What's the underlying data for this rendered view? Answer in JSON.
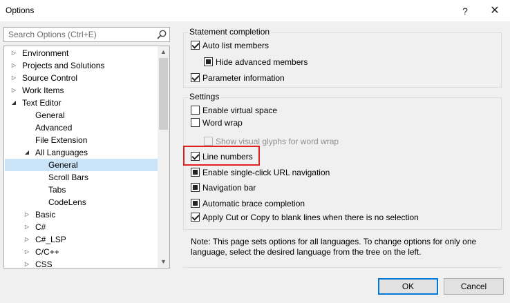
{
  "window": {
    "title": "Options",
    "help_glyph": "?",
    "close_glyph": "✕"
  },
  "search": {
    "placeholder": "Search Options (Ctrl+E)",
    "value": ""
  },
  "tree": {
    "items": [
      {
        "label": "Environment",
        "arrow": "closed"
      },
      {
        "label": "Projects and Solutions",
        "arrow": "closed"
      },
      {
        "label": "Source Control",
        "arrow": "closed"
      },
      {
        "label": "Work Items",
        "arrow": "closed"
      },
      {
        "label": "Text Editor",
        "arrow": "open"
      },
      {
        "label": "General",
        "arrow": "none"
      },
      {
        "label": "Advanced",
        "arrow": "none"
      },
      {
        "label": "File Extension",
        "arrow": "none"
      },
      {
        "label": "All Languages",
        "arrow": "open"
      },
      {
        "label": "General",
        "arrow": "none",
        "selected": true
      },
      {
        "label": "Scroll Bars",
        "arrow": "none"
      },
      {
        "label": "Tabs",
        "arrow": "none"
      },
      {
        "label": "CodeLens",
        "arrow": "none"
      },
      {
        "label": "Basic",
        "arrow": "closed"
      },
      {
        "label": "C#",
        "arrow": "closed"
      },
      {
        "label": "C#_LSP",
        "arrow": "closed"
      },
      {
        "label": "C/C++",
        "arrow": "closed"
      },
      {
        "label": "CSS",
        "arrow": "closed"
      }
    ]
  },
  "statement_completion": {
    "header": "Statement completion",
    "options": [
      {
        "label": "Auto list members",
        "state": "checked"
      },
      {
        "label": "Hide advanced members",
        "state": "indeterminate"
      },
      {
        "label": "Parameter information",
        "state": "checked"
      }
    ]
  },
  "settings": {
    "header": "Settings",
    "options": [
      {
        "label": "Enable virtual space",
        "state": "unchecked"
      },
      {
        "label": "Word wrap",
        "state": "unchecked"
      },
      {
        "label": "Show visual glyphs for word wrap",
        "state": "disabled"
      },
      {
        "label": "Line numbers",
        "state": "checked"
      },
      {
        "label": "Enable single-click URL navigation",
        "state": "indeterminate"
      },
      {
        "label": "Navigation bar",
        "state": "indeterminate"
      },
      {
        "label": "Automatic brace completion",
        "state": "indeterminate"
      },
      {
        "label": "Apply Cut or Copy to blank lines when there is no selection",
        "state": "checked"
      }
    ]
  },
  "note": "Note: This page sets options for all languages. To change options for only one language, select the desired language from the tree on the left.",
  "buttons": {
    "ok": "OK",
    "cancel": "Cancel"
  },
  "colors": {
    "highlight": "#e02020",
    "selection": "#cce4f7",
    "ok_border": "#0078d7"
  }
}
